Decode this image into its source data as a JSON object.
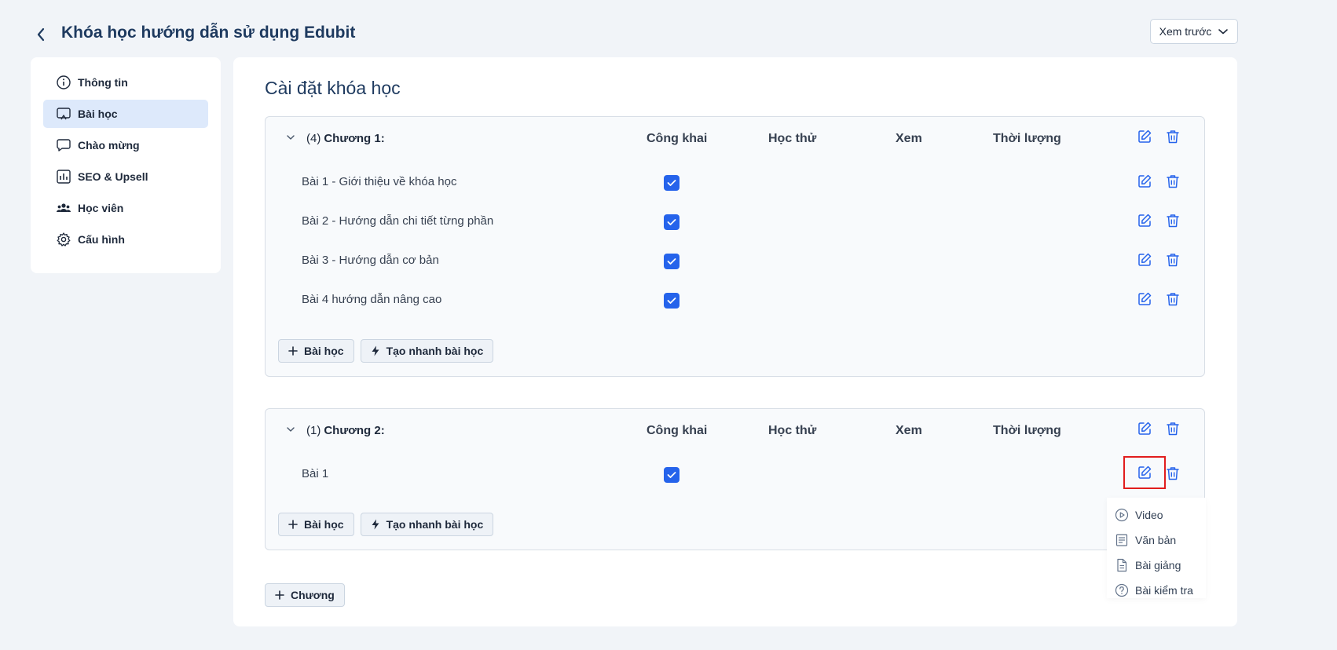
{
  "header": {
    "title": "Khóa học hướng dẫn sử dụng Edubit",
    "preview_label": "Xem trước"
  },
  "sidebar": {
    "items": [
      {
        "label": "Thông tin",
        "icon": "info-icon"
      },
      {
        "label": "Bài học",
        "icon": "lesson-screen-icon",
        "active": true
      },
      {
        "label": "Chào mừng",
        "icon": "chat-bubble-icon"
      },
      {
        "label": "SEO & Upsell",
        "icon": "bar-chart-icon"
      },
      {
        "label": "Học viên",
        "icon": "users-icon"
      },
      {
        "label": "Cấu hình",
        "icon": "gear-icon"
      }
    ]
  },
  "main": {
    "title": "Cài đặt khóa học",
    "columns": {
      "public": "Công khai",
      "trial": "Học thử",
      "view": "Xem",
      "duration": "Thời lượng"
    },
    "chapters": [
      {
        "count": "(4)",
        "name": "Chương 1:",
        "lessons": [
          {
            "name": "Bài 1 - Giới thiệu về khóa học",
            "public": true
          },
          {
            "name": "Bài 2 - Hướng dẫn chi tiết từng phần",
            "public": true
          },
          {
            "name": "Bài 3 - Hướng dẫn cơ bản",
            "public": true
          },
          {
            "name": "Bài 4 hướng dẫn nâng cao",
            "public": true
          }
        ]
      },
      {
        "count": "(1)",
        "name": "Chương 2:",
        "lessons": [
          {
            "name": "Bài 1",
            "public": true
          }
        ]
      }
    ],
    "add_lesson_label": "Bài học",
    "quick_create_label": "Tạo nhanh bài học",
    "add_chapter_label": "Chương"
  },
  "dropdown": {
    "items": [
      {
        "label": "Video",
        "icon": "play-circle-icon"
      },
      {
        "label": "Văn bản",
        "icon": "text-document-icon"
      },
      {
        "label": "Bài giảng",
        "icon": "file-icon"
      },
      {
        "label": "Bài kiểm tra",
        "icon": "question-circle-icon"
      }
    ]
  },
  "colors": {
    "accent": "#2563eb",
    "title": "#1e3a5f",
    "active_bg": "#dde9fb",
    "highlight": "#e11d1d"
  }
}
